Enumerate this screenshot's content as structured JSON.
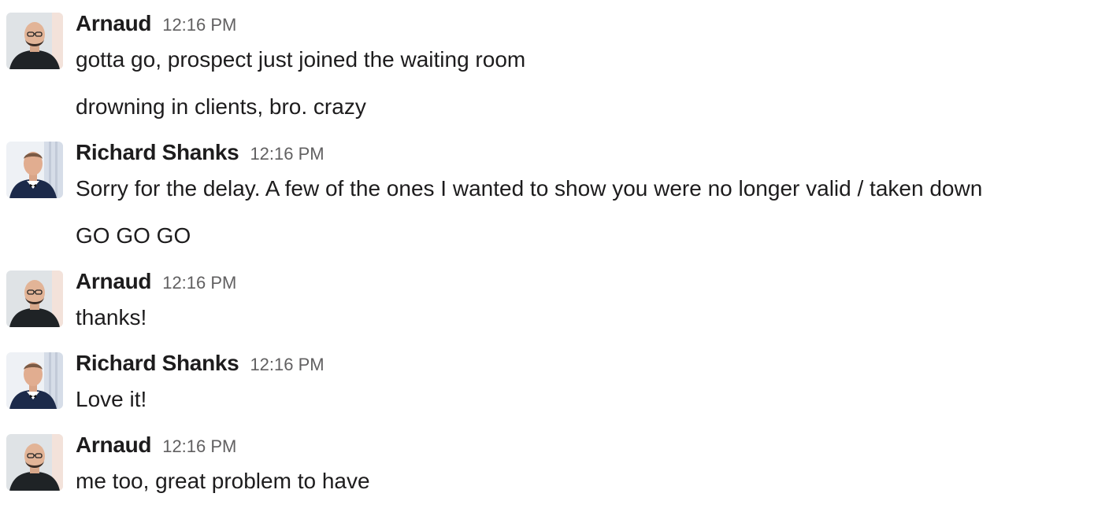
{
  "messages": [
    {
      "author": "Arnaud",
      "time": "12:16 PM",
      "avatar": "arnaud-avatar",
      "lines": [
        "gotta go, prospect just joined the waiting room",
        "drowning in clients, bro. crazy"
      ]
    },
    {
      "author": "Richard Shanks",
      "time": "12:16 PM",
      "avatar": "richard-avatar",
      "lines": [
        "Sorry for the delay. A few of the ones I wanted to show you were no longer valid / taken down",
        "GO GO GO"
      ]
    },
    {
      "author": "Arnaud",
      "time": "12:16 PM",
      "avatar": "arnaud-avatar",
      "lines": [
        "thanks!"
      ]
    },
    {
      "author": "Richard Shanks",
      "time": "12:16 PM",
      "avatar": "richard-avatar",
      "lines": [
        "Love it!"
      ]
    },
    {
      "author": "Arnaud",
      "time": "12:16 PM",
      "avatar": "arnaud-avatar",
      "lines": [
        "me too, great problem to have"
      ]
    }
  ],
  "colors": {
    "text": "#1d1c1d",
    "timestamp": "#616061",
    "background": "#ffffff"
  }
}
